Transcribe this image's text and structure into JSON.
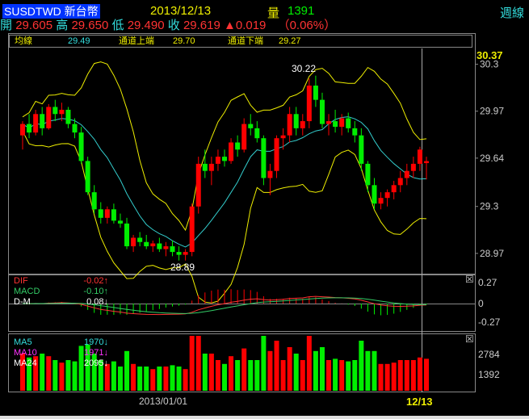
{
  "header": {
    "symbol": "SUSDTWD 新台幣",
    "date": "2013/12/13",
    "volume_label": "量",
    "volume_value": "1391",
    "period": "週線",
    "open_label": "開",
    "open_value": "29.605",
    "high_label": "高",
    "high_value": "29.650",
    "low_label": "低",
    "low_value": "29.490",
    "close_label": "收",
    "close_value": "29.619",
    "change_arrow": "▲",
    "change_value": "0.019",
    "change_pct": "（0.06%）"
  },
  "legend": {
    "ma_label": "均線",
    "ma_value": "29.49",
    "upper_label": "通道上端",
    "upper_value": "29.70",
    "lower_label": "通道下端",
    "lower_value": "29.27"
  },
  "panels": {
    "macd": {
      "rows": [
        {
          "name": "DIF",
          "value": "-0.02",
          "arrow": "↑"
        },
        {
          "name": "MACD",
          "value": "-0.10",
          "arrow": "↑"
        },
        {
          "name": "D-M",
          "value": "0.08",
          "arrow": "↓"
        }
      ],
      "ticks": [
        "0.27",
        "0",
        "-0.27"
      ]
    },
    "volume": {
      "rows": [
        {
          "name": "MA5",
          "value": "1970",
          "arrow": "↓"
        },
        {
          "name": "MA10",
          "value": "1971",
          "arrow": "↓"
        },
        {
          "name": "MA24",
          "value": "2095",
          "arrow": "↓"
        }
      ],
      "ticks": [
        "2784",
        "1392"
      ]
    }
  },
  "close_icon": "☒",
  "xaxis": {
    "start_label": "2013/01/01",
    "end_label": "12/13"
  },
  "price_ticks": [
    "30.3",
    "29.97",
    "29.64",
    "29.3",
    "28.97"
  ],
  "last_price_label": "30.37",
  "annotations": {
    "high": "30.22",
    "low": "28.89"
  },
  "colors": {
    "up": "#ff0000",
    "down": "#00ee00",
    "ma": "#33cccc",
    "band": "#eeee00",
    "bg": "#000000",
    "grid": "#888888",
    "dif": "#ff3333",
    "macd": "#33cc66"
  },
  "chart_data": {
    "type": "candlestick",
    "ylim": [
      28.85,
      30.4
    ],
    "candles": [
      [
        29.8,
        29.9,
        29.7,
        29.88
      ],
      [
        29.88,
        29.95,
        29.78,
        29.82
      ],
      [
        29.82,
        29.98,
        29.8,
        29.95
      ],
      [
        29.95,
        30.0,
        29.8,
        29.85
      ],
      [
        29.85,
        30.02,
        29.84,
        30.0
      ],
      [
        30.0,
        30.05,
        29.9,
        29.95
      ],
      [
        29.95,
        30.03,
        29.9,
        29.98
      ],
      [
        29.98,
        30.0,
        29.85,
        29.88
      ],
      [
        29.88,
        29.92,
        29.78,
        29.82
      ],
      [
        29.82,
        29.86,
        29.6,
        29.62
      ],
      [
        29.62,
        29.65,
        29.38,
        29.4
      ],
      [
        29.4,
        29.45,
        29.25,
        29.28
      ],
      [
        29.28,
        29.33,
        29.18,
        29.22
      ],
      [
        29.22,
        29.3,
        29.18,
        29.28
      ],
      [
        29.28,
        29.32,
        29.18,
        29.2
      ],
      [
        29.2,
        29.25,
        29.15,
        29.18
      ],
      [
        29.18,
        29.22,
        29.0,
        29.02
      ],
      [
        29.02,
        29.1,
        28.98,
        29.08
      ],
      [
        29.08,
        29.12,
        29.02,
        29.05
      ],
      [
        29.05,
        29.1,
        29.0,
        29.02
      ],
      [
        29.02,
        29.06,
        28.98,
        29.04
      ],
      [
        29.04,
        29.08,
        28.98,
        29.0
      ],
      [
        29.0,
        29.05,
        28.95,
        29.02
      ],
      [
        29.02,
        29.06,
        28.95,
        28.98
      ],
      [
        28.98,
        29.02,
        28.92,
        28.96
      ],
      [
        28.96,
        29.0,
        28.92,
        28.98
      ],
      [
        28.98,
        29.32,
        28.95,
        29.3
      ],
      [
        29.3,
        29.65,
        29.25,
        29.6
      ],
      [
        29.6,
        29.7,
        29.5,
        29.55
      ],
      [
        29.55,
        29.65,
        29.45,
        29.6
      ],
      [
        29.6,
        29.7,
        29.55,
        29.65
      ],
      [
        29.65,
        29.7,
        29.58,
        29.62
      ],
      [
        29.62,
        29.78,
        29.6,
        29.75
      ],
      [
        29.75,
        29.8,
        29.65,
        29.7
      ],
      [
        29.7,
        29.92,
        29.68,
        29.88
      ],
      [
        29.88,
        29.95,
        29.8,
        29.85
      ],
      [
        29.85,
        29.9,
        29.75,
        29.78
      ],
      [
        29.78,
        29.8,
        29.45,
        29.5
      ],
      [
        29.5,
        29.6,
        29.38,
        29.55
      ],
      [
        29.55,
        29.8,
        29.5,
        29.78
      ],
      [
        29.78,
        29.85,
        29.7,
        29.8
      ],
      [
        29.8,
        30.0,
        29.75,
        29.95
      ],
      [
        29.95,
        30.0,
        29.8,
        29.85
      ],
      [
        29.85,
        29.95,
        29.8,
        29.9
      ],
      [
        29.9,
        30.2,
        29.85,
        30.15
      ],
      [
        30.15,
        30.22,
        30.0,
        30.05
      ],
      [
        30.05,
        30.1,
        29.85,
        29.88
      ],
      [
        29.88,
        29.95,
        29.8,
        29.9
      ],
      [
        29.9,
        29.98,
        29.82,
        29.86
      ],
      [
        29.86,
        29.95,
        29.8,
        29.92
      ],
      [
        29.92,
        29.96,
        29.82,
        29.85
      ],
      [
        29.85,
        29.9,
        29.75,
        29.8
      ],
      [
        29.8,
        29.85,
        29.55,
        29.6
      ],
      [
        29.6,
        29.62,
        29.4,
        29.45
      ],
      [
        29.45,
        29.5,
        29.28,
        29.32
      ],
      [
        29.32,
        29.4,
        29.28,
        29.36
      ],
      [
        29.36,
        29.42,
        29.3,
        29.4
      ],
      [
        29.4,
        29.48,
        29.35,
        29.45
      ],
      [
        29.45,
        29.55,
        29.4,
        29.5
      ],
      [
        29.5,
        29.6,
        29.45,
        29.55
      ],
      [
        29.55,
        29.65,
        29.5,
        29.6
      ],
      [
        29.6,
        29.72,
        29.55,
        29.7
      ],
      [
        29.605,
        29.65,
        29.49,
        29.619
      ]
    ]
  }
}
